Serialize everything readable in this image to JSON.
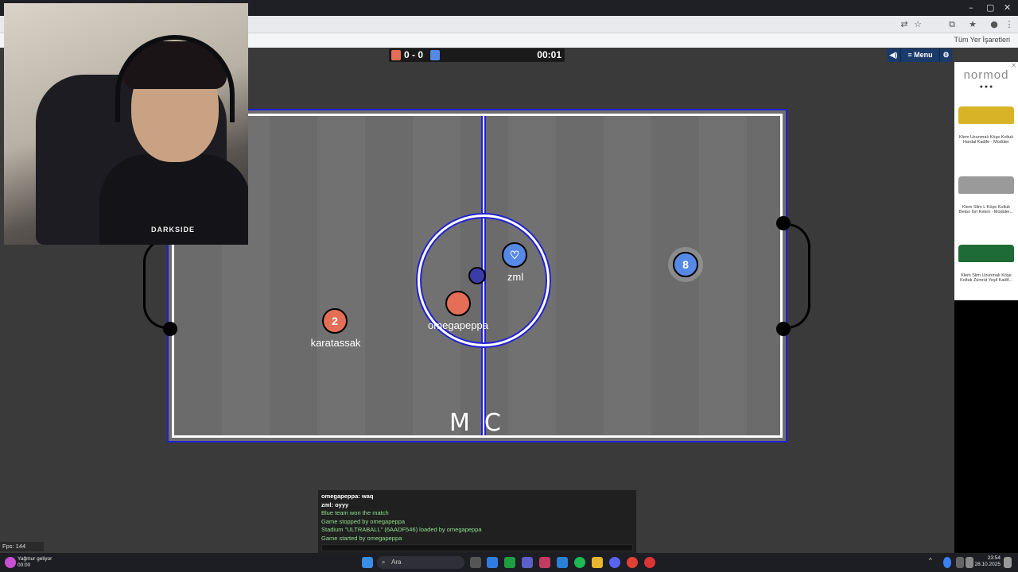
{
  "browser": {
    "bookmarks_label": "Tüm Yer İşaretleri",
    "window_controls": [
      "–",
      "▢",
      "✕"
    ]
  },
  "scoreboard": {
    "score": "0 - 0",
    "time": "00:01",
    "red_color": "#e56e56",
    "blue_color": "#5689e5"
  },
  "top_menu": {
    "sound_icon": "speaker-icon",
    "menu_label": "≡ Menu",
    "settings_icon": "gear-icon"
  },
  "players": [
    {
      "name": "karatassak",
      "avatar": "2",
      "team": "red"
    },
    {
      "name": "omegapeppa",
      "avatar": "",
      "team": "red"
    },
    {
      "name": "zml",
      "avatar": "♡",
      "team": "blue"
    },
    {
      "name": "",
      "avatar": "8",
      "team": "blue"
    }
  ],
  "pitch": {
    "logo": "MC"
  },
  "webcam": {
    "shirt_text": "DARKSIDE"
  },
  "ad": {
    "brand": "normod",
    "dots": "● ● ●",
    "close": "✕",
    "items": [
      {
        "caption": "Klem Uzunmalı Köşe Koltuk Hardal Kadife - Modüler",
        "color": "#d8b325"
      },
      {
        "caption": "Klem Slim L Köşe Koltuk Beton Gri Keten - Modüler...",
        "color": "#9a9a9a"
      },
      {
        "caption": "Klem Slim Uzunmalı Köşe Koltuk Zümrüt Yeşil Kadif...",
        "color": "#1f6b35"
      }
    ]
  },
  "chat": {
    "messages": [
      {
        "text": "omegapeppa: waq",
        "color": "#ffffff"
      },
      {
        "text": "zml: oyyy",
        "color": "#ffffff"
      },
      {
        "text": "Blue team won the match",
        "color": "#8fe08f"
      },
      {
        "text": "Game stopped by omegapeppa",
        "color": "#8fe08f"
      },
      {
        "text": "Stadium \"ULTRABALL\" (6AADF546) loaded by omegapeppa",
        "color": "#8fe08f"
      },
      {
        "text": "Game started by omegapeppa",
        "color": "#8fe08f"
      }
    ]
  },
  "fps": "Fps: 144",
  "taskbar": {
    "weather_line1": "Yağmur geliyor",
    "weather_line2": "00:00",
    "search_placeholder": "Ara",
    "time": "23:54",
    "date": "28.10.2025"
  }
}
